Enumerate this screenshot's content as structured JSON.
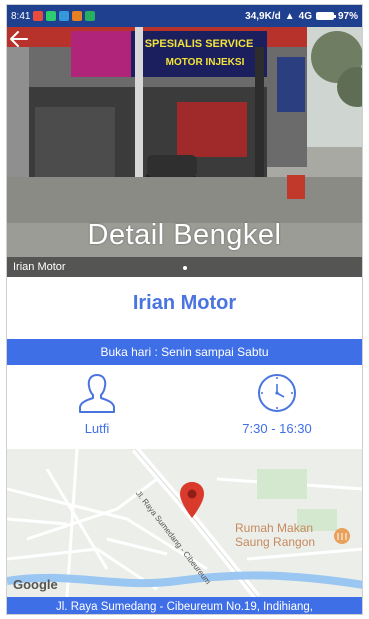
{
  "status_bar": {
    "time": "8:41",
    "speed": "34,9K/d",
    "network": "4G",
    "battery": "97%"
  },
  "hero": {
    "title": "Detail Bengkel",
    "caption": "Irian Motor",
    "sign_text": "SPESIALIS SERVICE",
    "sign_text_2": "MOTOR INJEKSI",
    "slide_count": 1
  },
  "shop": {
    "name": "Irian Motor",
    "open_days": "Buka hari : Senin sampai Sabtu",
    "owner": "Lutfi",
    "hours": "7:30 - 16:30"
  },
  "map": {
    "road_label": "Jl. Raya Sumedang - Cibeureum",
    "poi_line1": "Rumah Makan",
    "poi_line2": "Saung Rangon",
    "provider": "Google"
  },
  "address": "Jl. Raya Sumedang - Cibeureum No.19, Indihiang,",
  "colors": {
    "primary": "#3f6fe6",
    "status_bar": "#1f3f8f",
    "pin": "#d93a2b"
  }
}
